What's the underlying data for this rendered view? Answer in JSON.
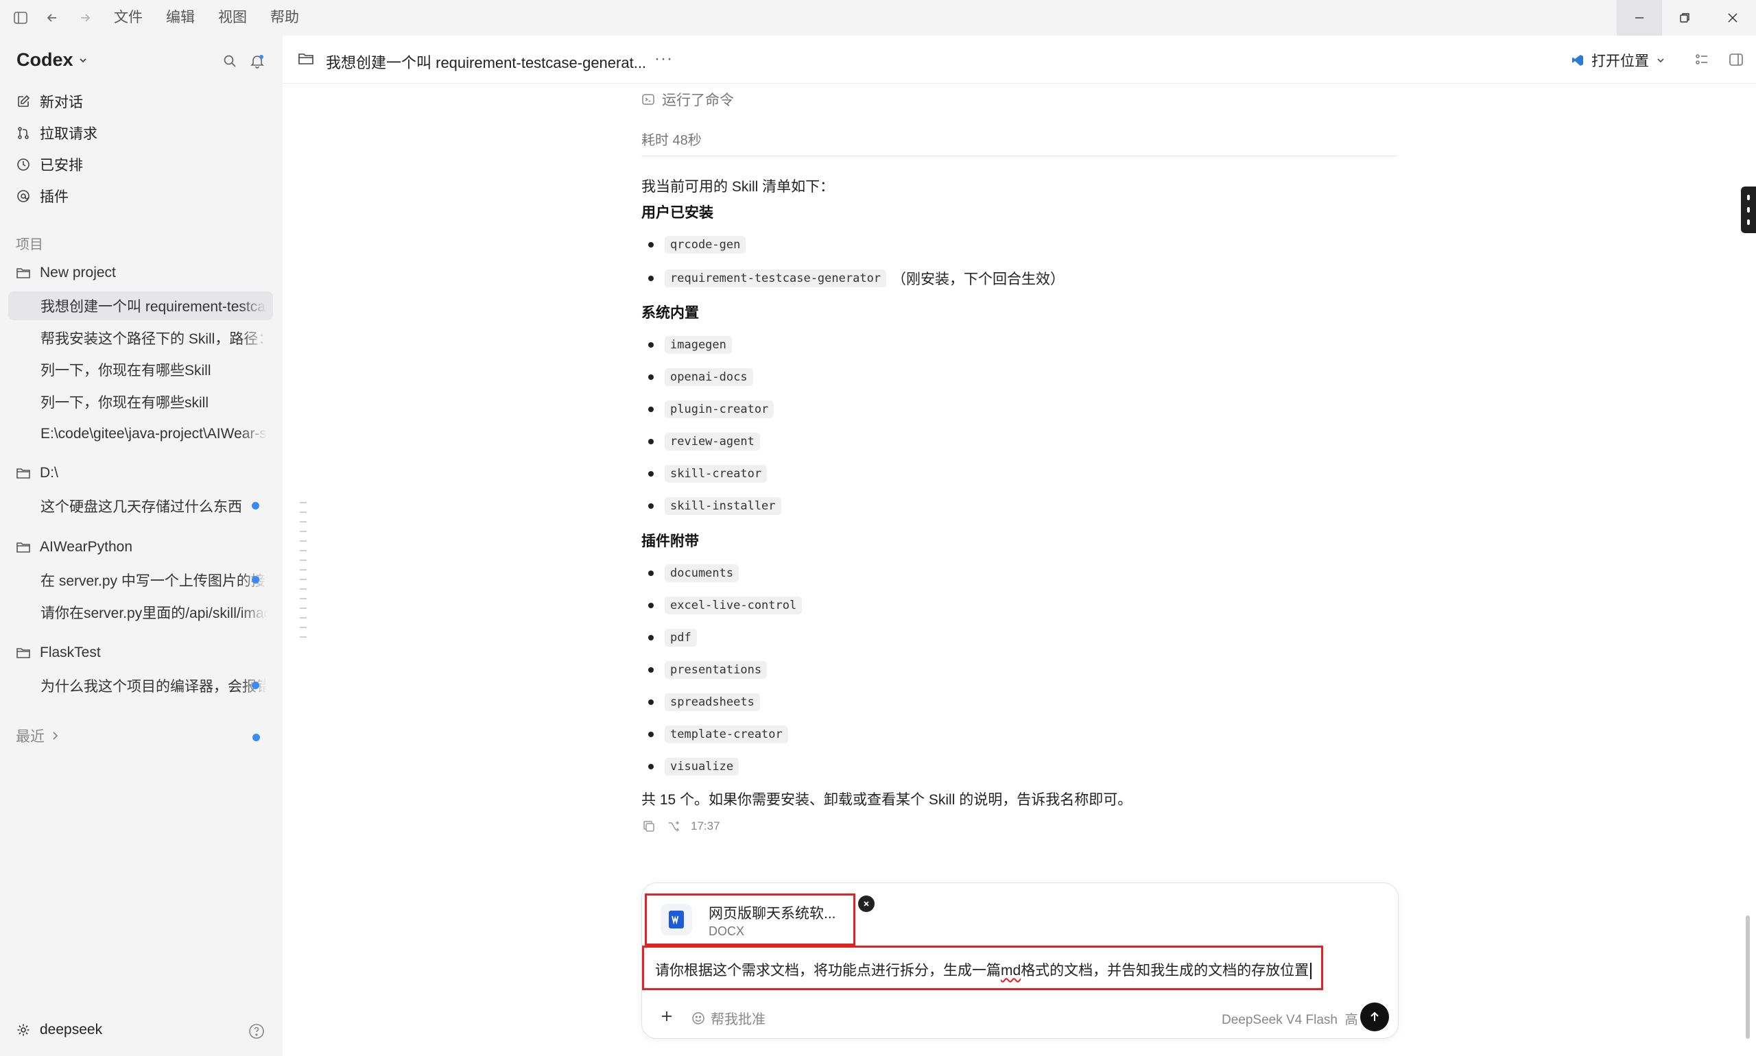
{
  "menu": {
    "file": "文件",
    "edit": "编辑",
    "view": "视图",
    "help": "帮助"
  },
  "sidebar": {
    "brand": "Codex",
    "nav": [
      {
        "label": "新对话",
        "icon": "edit-icon"
      },
      {
        "label": "拉取请求",
        "icon": "git-pull-request-icon"
      },
      {
        "label": "已安排",
        "icon": "clock-icon"
      },
      {
        "label": "插件",
        "icon": "plugin-icon"
      }
    ],
    "projects_label": "项目",
    "projects": [
      {
        "name": "New project",
        "threads": [
          {
            "title": "我想创建一个叫 requirement-testcase-generator",
            "active": true,
            "unread": false
          },
          {
            "title": "帮我安装这个路径下的 Skill，路径：",
            "active": false,
            "unread": false
          },
          {
            "title": "列一下，你现在有哪些Skill",
            "active": false,
            "unread": false
          },
          {
            "title": "列一下，你现在有哪些skill",
            "active": false,
            "unread": false
          },
          {
            "title": "E:\\code\\gitee\\java-project\\AIWear-server",
            "active": false,
            "unread": false
          }
        ]
      },
      {
        "name": "D:\\",
        "threads": [
          {
            "title": "这个硬盘这几天存储过什么东西",
            "active": false,
            "unread": true
          }
        ]
      },
      {
        "name": "AIWearPython",
        "threads": [
          {
            "title": "在 server.py 中写一个上传图片的接口",
            "active": false,
            "unread": true
          },
          {
            "title": "请你在server.py里面的/api/skill/image",
            "active": false,
            "unread": false
          }
        ]
      },
      {
        "name": "FlaskTest",
        "threads": [
          {
            "title": "为什么我这个项目的编译器，会报错",
            "active": false,
            "unread": true
          }
        ]
      }
    ],
    "recent_label": "最近",
    "user": "deepseek"
  },
  "header": {
    "title": "我想创建一个叫 requirement-testcase-generat...",
    "more": "···",
    "open_location": "打开位置"
  },
  "message": {
    "ran_command": "运行了命令",
    "duration": "耗时 48秒",
    "intro": "我当前可用的 Skill 清单如下：",
    "groups": [
      {
        "title": "用户已安装",
        "skills": [
          {
            "name": "qrcode-gen",
            "note": ""
          },
          {
            "name": "requirement-testcase-generator",
            "note": "（刚安装，下个回合生效）"
          }
        ]
      },
      {
        "title": "系统内置",
        "skills": [
          {
            "name": "imagegen",
            "note": ""
          },
          {
            "name": "openai-docs",
            "note": ""
          },
          {
            "name": "plugin-creator",
            "note": ""
          },
          {
            "name": "review-agent",
            "note": ""
          },
          {
            "name": "skill-creator",
            "note": ""
          },
          {
            "name": "skill-installer",
            "note": ""
          }
        ]
      },
      {
        "title": "插件附带",
        "skills": [
          {
            "name": "documents",
            "note": ""
          },
          {
            "name": "excel-live-control",
            "note": ""
          },
          {
            "name": "pdf",
            "note": ""
          },
          {
            "name": "presentations",
            "note": ""
          },
          {
            "name": "spreadsheets",
            "note": ""
          },
          {
            "name": "template-creator",
            "note": ""
          },
          {
            "name": "visualize",
            "note": ""
          }
        ]
      }
    ],
    "summary": "共 15 个。如果你需要安装、卸载或查看某个 Skill 的说明，告诉我名称即可。",
    "time": "17:37"
  },
  "composer": {
    "attachment": {
      "name": "网页版聊天系统软...",
      "type": "DOCX"
    },
    "input_before": "请你根据这个需求文档，将功能点进行拆分，生成一篇",
    "input_misspelled": "md",
    "input_after": "格式的文档，并告知我生成的文档的存放位置",
    "approve_label": "帮我批准",
    "model": "DeepSeek V4 Flash",
    "effort": "高"
  },
  "colors": {
    "accent": "#3b8af6",
    "highlight_border": "#e02424",
    "sidebar_bg": "#f4f4f5"
  }
}
